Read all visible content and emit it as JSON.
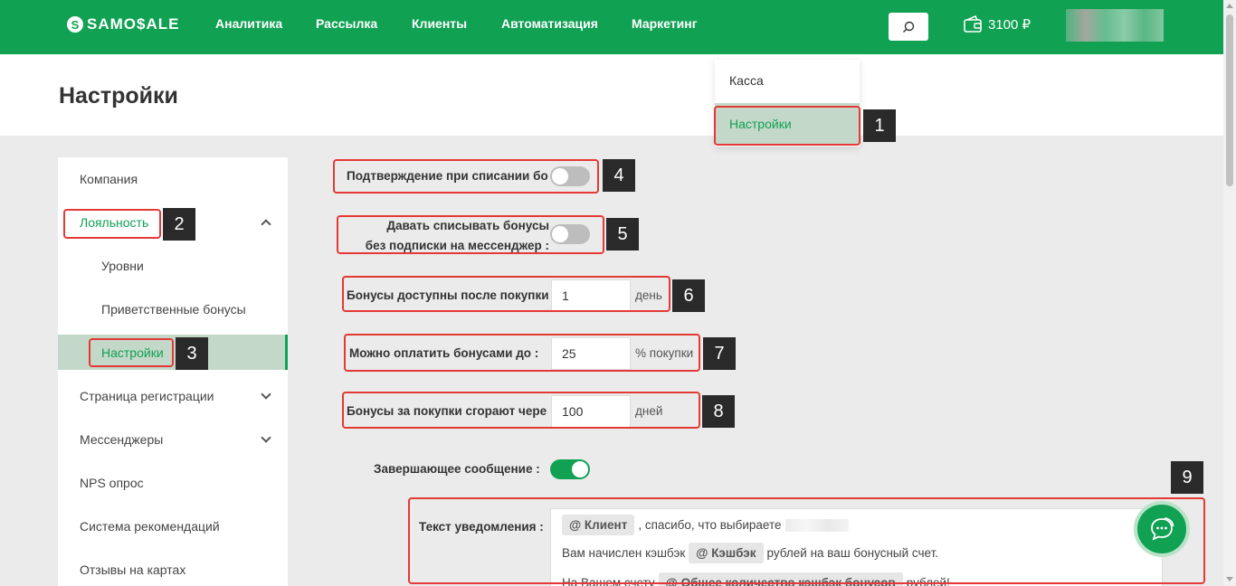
{
  "header": {
    "logo_text": "SAMO$ALE",
    "logo_mark": "S",
    "nav": [
      "Аналитика",
      "Рассылка",
      "Клиенты",
      "Автоматизация",
      "Маркетинг"
    ],
    "search_icon": "search-icon",
    "balance": "3100 ₽",
    "wallet_icon": "wallet-icon"
  },
  "page": {
    "title": "Настройки"
  },
  "dropdown": {
    "items": [
      "Касса",
      "Настройки"
    ],
    "active": "Настройки"
  },
  "sidebar": {
    "items": [
      "Компания",
      "Лояльность",
      "Уровни",
      "Приветственные бонусы",
      "Настройки",
      "Страница регистрации",
      "Мессенджеры",
      "NPS опрос",
      "Система рекомендаций",
      "Отзывы на картах"
    ]
  },
  "form": {
    "confirm_writeoff": {
      "label": "Подтверждение при списании бо",
      "enabled": false
    },
    "allow_no_sub": {
      "label_line1": "Давать списывать бонусы",
      "label_line2": "без подписки на мессенджер :",
      "enabled": false
    },
    "available_after": {
      "label": "Бонусы доступны после покупки",
      "value": "1",
      "suffix": "день"
    },
    "pay_up_to": {
      "label": "Можно оплатить бонусами до :",
      "value": "25",
      "suffix": "% покупки"
    },
    "expire_after": {
      "label": "Бонусы за покупки сгорают чере",
      "value": "100",
      "suffix": "дней"
    },
    "final_message": {
      "label": "Завершающее сообщение :",
      "enabled": true
    },
    "notification": {
      "label": "Текст уведомления :",
      "line1_tag": "@ Клиент",
      "line1_text": ", спасибо, что выбираете",
      "line2_pre": "Вам начислен кэшбэк",
      "line2_tag": "@ Кэшбэк",
      "line2_post": "рублей на ваш бонусный счет.",
      "line3_pre": "На Вашем счету",
      "line3_tag": "@ Общее количество кэшбэк бонусов",
      "line3_post": "рублей!"
    }
  },
  "annotations": [
    "1",
    "2",
    "3",
    "4",
    "5",
    "6",
    "7",
    "8",
    "9"
  ],
  "colors": {
    "brand_green": "#10a153",
    "highlight_green": "#c3d8c9",
    "annotation_red": "#e53935"
  }
}
